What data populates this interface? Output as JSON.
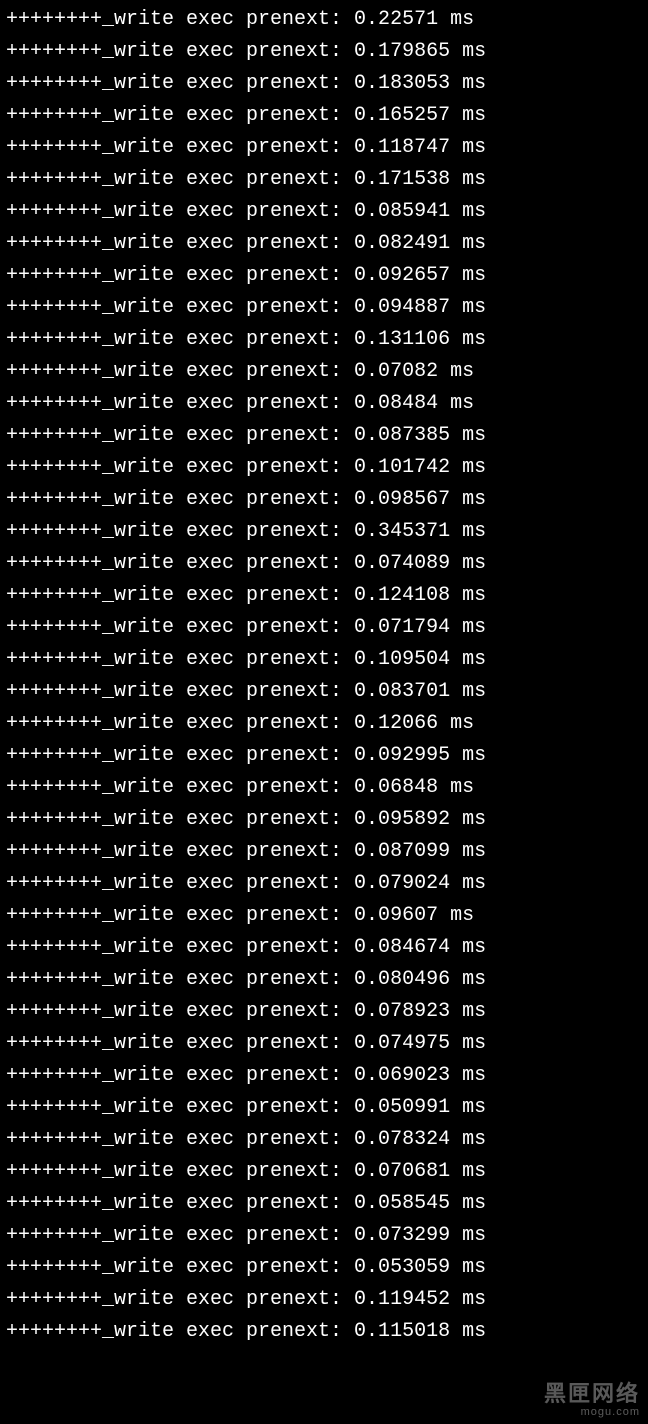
{
  "log": {
    "prefix": "++++++++_write exec prenext: ",
    "unit": " ms",
    "values": [
      "0.22571",
      "0.179865",
      "0.183053",
      "0.165257",
      "0.118747",
      "0.171538",
      "0.085941",
      "0.082491",
      "0.092657",
      "0.094887",
      "0.131106",
      "0.07082",
      "0.08484",
      "0.087385",
      "0.101742",
      "0.098567",
      "0.345371",
      "0.074089",
      "0.124108",
      "0.071794",
      "0.109504",
      "0.083701",
      "0.12066",
      "0.092995",
      "0.06848",
      "0.095892",
      "0.087099",
      "0.079024",
      "0.09607",
      "0.084674",
      "0.080496",
      "0.078923",
      "0.074975",
      "0.069023",
      "0.050991",
      "0.078324",
      "0.070681",
      "0.058545",
      "0.073299",
      "0.053059",
      "0.119452",
      "0.115018"
    ]
  },
  "watermark": {
    "main": "黑匣网络",
    "sub": "mogu.com"
  }
}
